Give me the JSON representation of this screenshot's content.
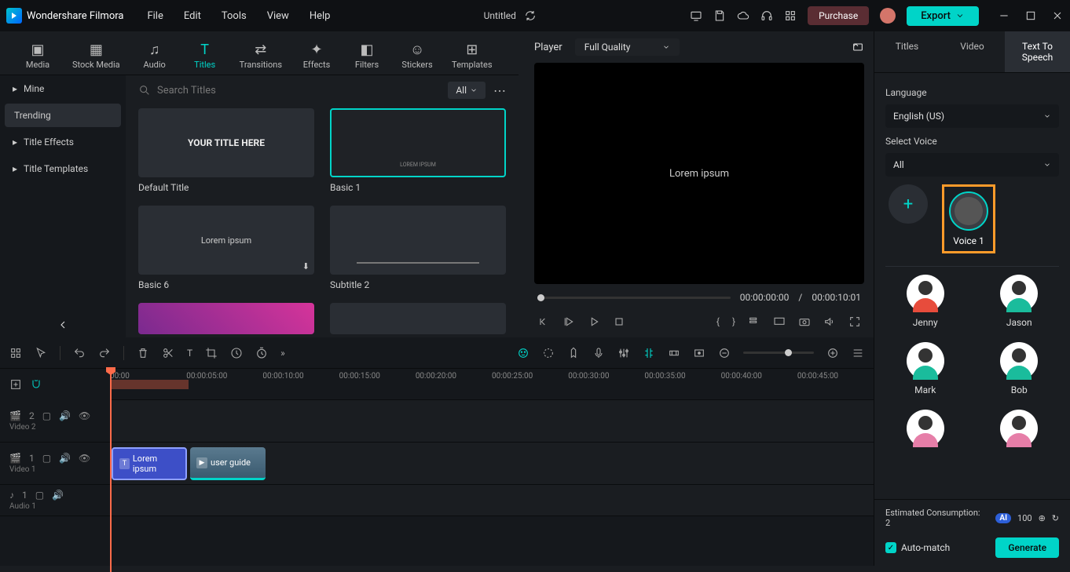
{
  "app": {
    "name": "Wondershare Filmora",
    "document": "Untitled"
  },
  "menu": [
    "File",
    "Edit",
    "Tools",
    "View",
    "Help"
  ],
  "titlebar": {
    "purchase": "Purchase",
    "export": "Export"
  },
  "mediaTabs": [
    "Media",
    "Stock Media",
    "Audio",
    "Titles",
    "Transitions",
    "Effects",
    "Filters",
    "Stickers",
    "Templates"
  ],
  "mediaActiveTab": "Titles",
  "sidebar": {
    "items": [
      "Mine",
      "Trending",
      "Title Effects",
      "Title Templates"
    ],
    "active": "Trending"
  },
  "search": {
    "placeholder": "Search Titles",
    "filter": "All"
  },
  "titles": [
    {
      "label": "Default Title",
      "thumb": "YOUR TITLE HERE",
      "selected": false
    },
    {
      "label": "Basic 1",
      "thumb": "LOREM IPSUM",
      "selected": true
    },
    {
      "label": "Basic 6",
      "thumb": "Lorem ipsum",
      "selected": false
    },
    {
      "label": "Subtitle 2",
      "thumb": "",
      "selected": false
    }
  ],
  "player": {
    "label": "Player",
    "quality": "Full Quality",
    "overlay": "Lorem ipsum",
    "current": "00:00:00:00",
    "total": "00:00:10:01"
  },
  "rightPanel": {
    "tabs": [
      "Titles",
      "Video",
      "Text To Speech"
    ],
    "active": "Text To Speech",
    "languageLabel": "Language",
    "language": "English (US)",
    "selectVoiceLabel": "Select Voice",
    "voiceFilter": "All",
    "selectedVoice": "Voice 1",
    "voices": [
      "Jenny",
      "Jason",
      "Mark",
      "Bob"
    ],
    "consumption": "Estimated Consumption: 2",
    "aiCredits": "100",
    "autoMatch": "Auto-match",
    "generate": "Generate"
  },
  "timeline": {
    "marks": [
      "00:00",
      "00:00:05:00",
      "00:00:10:00",
      "00:00:15:00",
      "00:00:20:00",
      "00:00:25:00",
      "00:00:30:00",
      "00:00:35:00",
      "00:00:40:00",
      "00:00:45:00"
    ],
    "tracks": [
      {
        "label": "Video 2",
        "type": "video"
      },
      {
        "label": "Video 1",
        "type": "video"
      },
      {
        "label": "Audio 1",
        "type": "audio"
      }
    ],
    "clips": {
      "title": "Lorem ipsum",
      "video": "user guide"
    }
  }
}
